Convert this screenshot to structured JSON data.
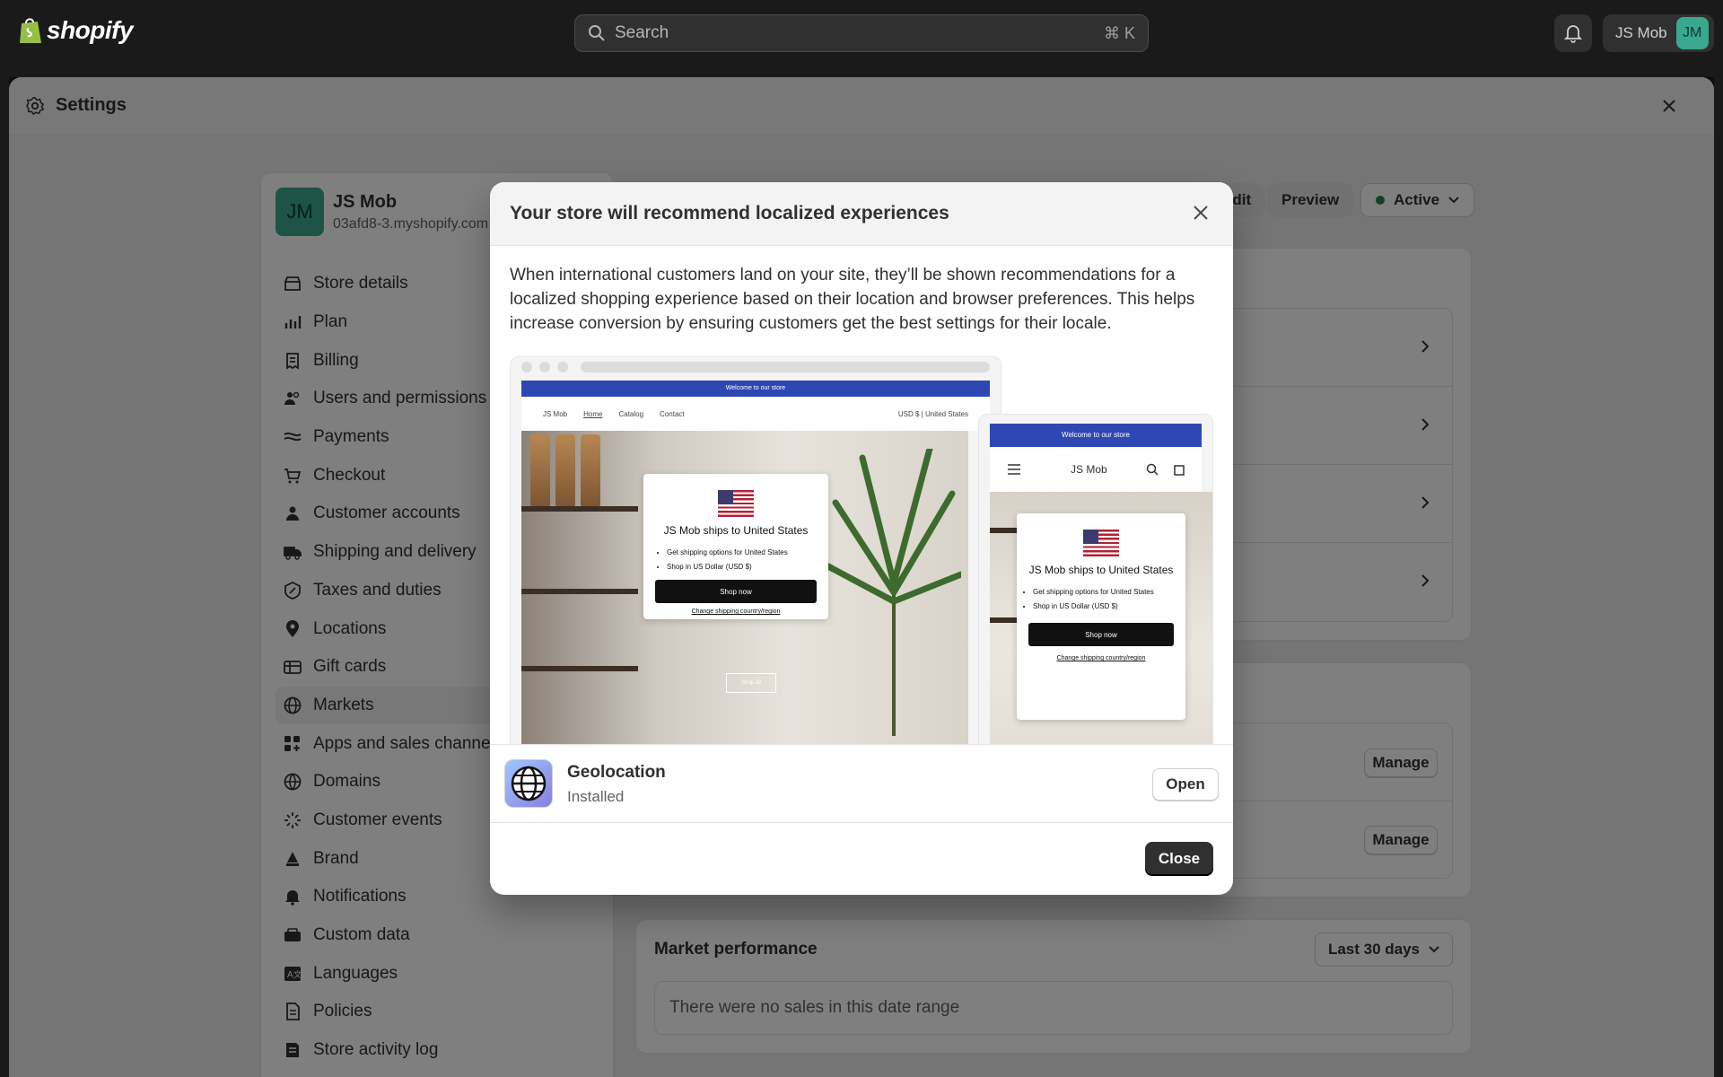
{
  "topbar": {
    "brand": "shopify",
    "search_placeholder": "Search",
    "search_shortcut": "⌘ K",
    "user_name": "JS Mob",
    "user_initials": "JM"
  },
  "settings": {
    "title": "Settings",
    "store": {
      "name": "JS Mob",
      "url": "03afd8-3.myshopify.com",
      "initials": "JM"
    },
    "nav": [
      {
        "label": "Store details",
        "icon": "store-icon"
      },
      {
        "label": "Plan",
        "icon": "plan-icon"
      },
      {
        "label": "Billing",
        "icon": "billing-icon"
      },
      {
        "label": "Users and permissions",
        "icon": "users-icon"
      },
      {
        "label": "Payments",
        "icon": "payments-icon"
      },
      {
        "label": "Checkout",
        "icon": "cart-icon"
      },
      {
        "label": "Customer accounts",
        "icon": "person-icon"
      },
      {
        "label": "Shipping and delivery",
        "icon": "truck-icon"
      },
      {
        "label": "Taxes and duties",
        "icon": "tax-icon"
      },
      {
        "label": "Locations",
        "icon": "location-icon"
      },
      {
        "label": "Gift cards",
        "icon": "gift-card-icon"
      },
      {
        "label": "Markets",
        "icon": "globe-icon",
        "active": true
      },
      {
        "label": "Apps and sales channels",
        "icon": "apps-icon"
      },
      {
        "label": "Domains",
        "icon": "domain-icon"
      },
      {
        "label": "Customer events",
        "icon": "events-icon"
      },
      {
        "label": "Brand",
        "icon": "brand-icon"
      },
      {
        "label": "Notifications",
        "icon": "bell-icon"
      },
      {
        "label": "Custom data",
        "icon": "custom-data-icon"
      },
      {
        "label": "Languages",
        "icon": "language-icon"
      },
      {
        "label": "Policies",
        "icon": "policies-icon"
      },
      {
        "label": "Store activity log",
        "icon": "activity-icon"
      }
    ],
    "main": {
      "edit_label": "Edit",
      "preview_label": "Preview",
      "status_label": "Active",
      "manage_label": "Manage",
      "performance_title": "Market performance",
      "date_range": "Last 30 days",
      "empty_message": "There were no sales in this date range"
    }
  },
  "modal": {
    "title": "Your store will recommend localized experiences",
    "body": "When international customers land on your site, they’ll be shown recommendations for a localized shopping experience based on their location and browser preferences. This helps increase conversion by ensuring customers get the best settings for their locale.",
    "preview": {
      "announcement": "Welcome to our store",
      "store_name": "JS Mob",
      "nav_home": "Home",
      "nav_catalog": "Catalog",
      "nav_contact": "Contact",
      "currency_selector": "USD $ | United States",
      "popup_title_desktop": "JS Mob ships to United States",
      "popup_title_mobile": "JS Mob ships to United States",
      "bullet_1_desktop": "Get shipping options for United States",
      "bullet_1_mobile": "Get shipping options for United States",
      "bullet_2": "Shop in US Dollar (USD $)",
      "shop_now": "Shop now",
      "change_link": "Change shipping country/region",
      "shop_all": "Shop all"
    },
    "app": {
      "name": "Geolocation",
      "status": "Installed",
      "open_label": "Open"
    },
    "close_label": "Close"
  }
}
